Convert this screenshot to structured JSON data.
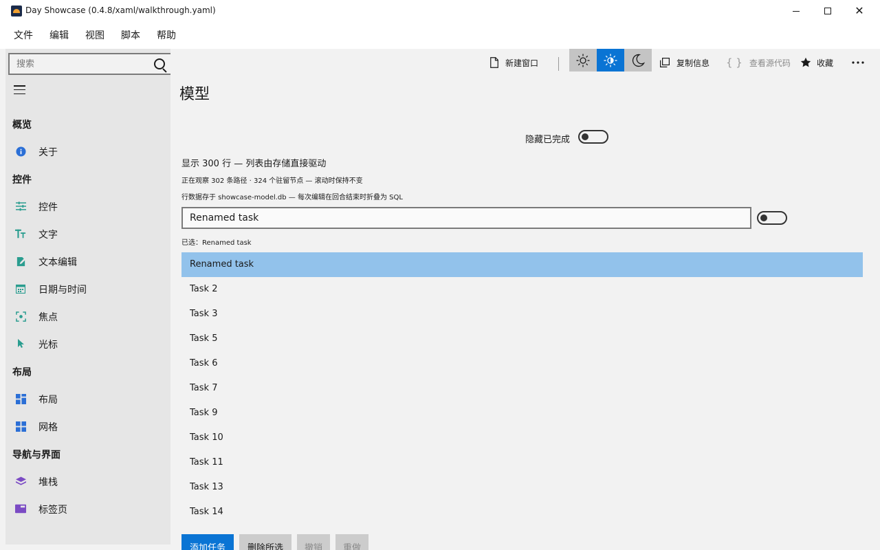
{
  "window": {
    "title": "Day Showcase (0.4.8/xaml/walkthrough.yaml)",
    "minimize_glyph": "",
    "close_glyph": "✕"
  },
  "menu": [
    "文件",
    "编辑",
    "视图",
    "脚本",
    "帮助"
  ],
  "sidebar": {
    "search_placeholder": "搜索",
    "sections": [
      {
        "title": "概览",
        "items": [
          {
            "label": "关于",
            "icon": "info-icon",
            "color": "#2b6fd6"
          }
        ]
      },
      {
        "title": "控件",
        "items": [
          {
            "label": "控件",
            "icon": "sliders-icon",
            "color": "#2a9d8f"
          },
          {
            "label": "文字",
            "icon": "text-icon",
            "color": "#2a9d8f"
          },
          {
            "label": "文本编辑",
            "icon": "edit-icon",
            "color": "#2a9d8f"
          },
          {
            "label": "日期与时间",
            "icon": "calendar-icon",
            "color": "#2a9d8f"
          },
          {
            "label": "焦点",
            "icon": "focus-icon",
            "color": "#2a9d8f"
          },
          {
            "label": "光标",
            "icon": "cursor-icon",
            "color": "#2a9d8f"
          }
        ]
      },
      {
        "title": "布局",
        "items": [
          {
            "label": "布局",
            "icon": "layout-icon",
            "color": "#2b6fd6"
          },
          {
            "label": "网格",
            "icon": "grid-icon",
            "color": "#2b6fd6"
          }
        ]
      },
      {
        "title": "导航与界面",
        "items": [
          {
            "label": "堆栈",
            "icon": "stack-icon",
            "color": "#7b4bc4"
          },
          {
            "label": "标签页",
            "icon": "tabs-icon",
            "color": "#7b4bc4"
          }
        ]
      }
    ]
  },
  "toolbar": {
    "new_window": "新建窗口",
    "copy_info": "复制信息",
    "view_source": "查看源代码",
    "favorite": "收藏",
    "accent": "#0a74d4"
  },
  "content": {
    "title": "模型",
    "hide_completed_label": "隐藏已完成",
    "summary": "显示 300 行 — 列表由存储直接驱动",
    "observing": "正在观察 302 条路径 · 324 个驻留节点 — 滚动时保持不变",
    "storage_note": "行数据存于 showcase-model.db — 每次编辑在回合结束时折叠为 SQL",
    "input_value": "Renamed task",
    "selected_text": "已选：Renamed task",
    "rows": [
      "Renamed task",
      "Task 2",
      "Task 3",
      "Task 5",
      "Task 6",
      "Task 7",
      "Task 9",
      "Task 10",
      "Task 11",
      "Task 13",
      "Task 14"
    ],
    "buttons": {
      "add": "添加任务",
      "delete": "删除所选",
      "undo": "撤销",
      "redo": "重做"
    }
  }
}
